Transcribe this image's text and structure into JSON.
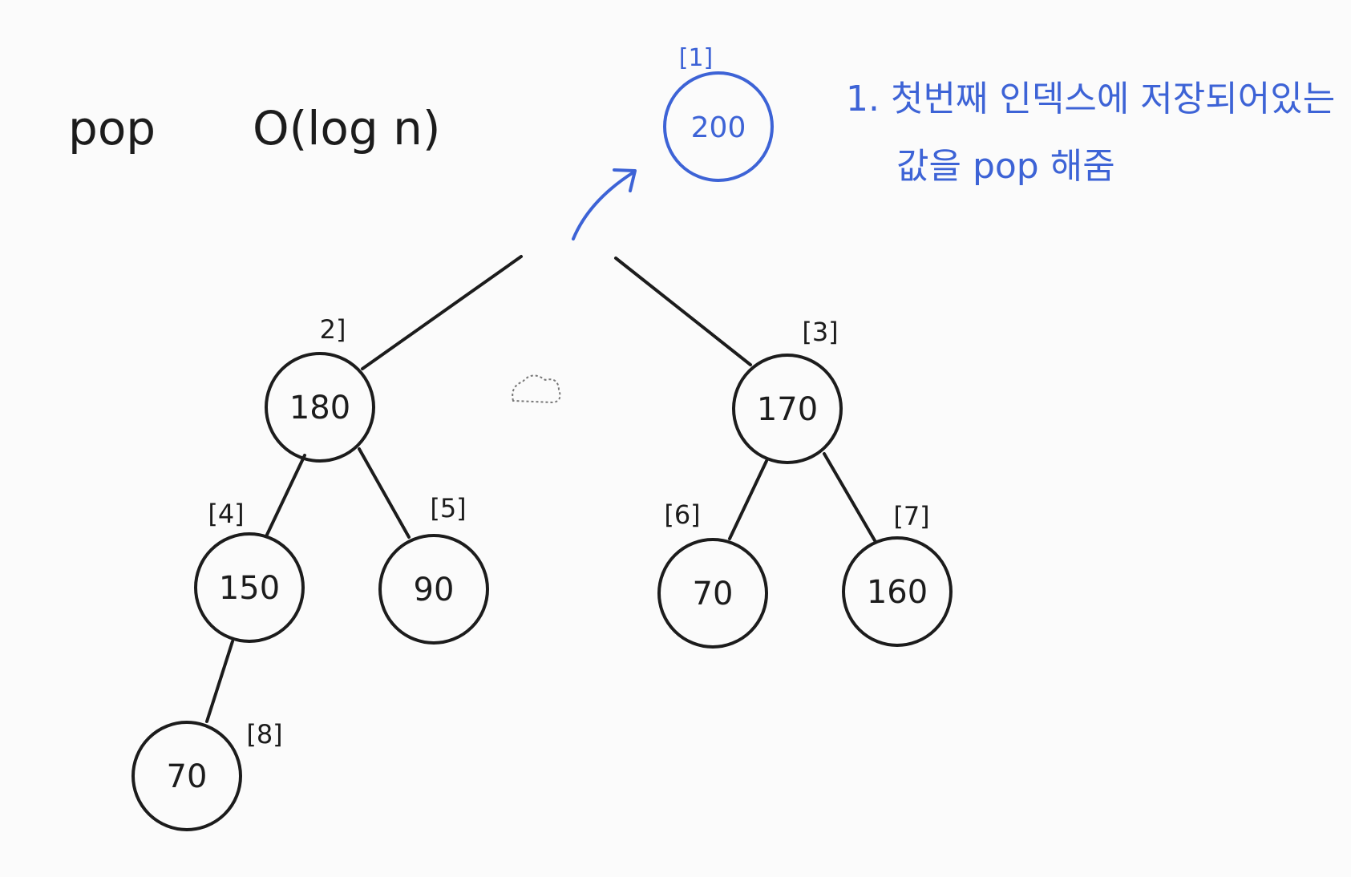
{
  "header": {
    "operation": "pop",
    "complexity": "O(log n)"
  },
  "note": {
    "line1": "1. 첫번째 인덱스에 저장되어있는",
    "line2": "값을 pop 해줌"
  },
  "colors": {
    "ink": "#1c1c1c",
    "accent": "#3d63d6"
  },
  "nodes": [
    {
      "id": "root",
      "index_label": "[1]",
      "value": "200",
      "popped": true
    },
    {
      "id": "n2",
      "index_label": "2]",
      "value": "180"
    },
    {
      "id": "n3",
      "index_label": "[3]",
      "value": "170"
    },
    {
      "id": "n4",
      "index_label": "[4]",
      "value": "150"
    },
    {
      "id": "n5",
      "index_label": "[5]",
      "value": "90"
    },
    {
      "id": "n6",
      "index_label": "[6]",
      "value": "70"
    },
    {
      "id": "n7",
      "index_label": "[7]",
      "value": "160"
    },
    {
      "id": "n8",
      "index_label": "[8]",
      "value": "70"
    }
  ]
}
